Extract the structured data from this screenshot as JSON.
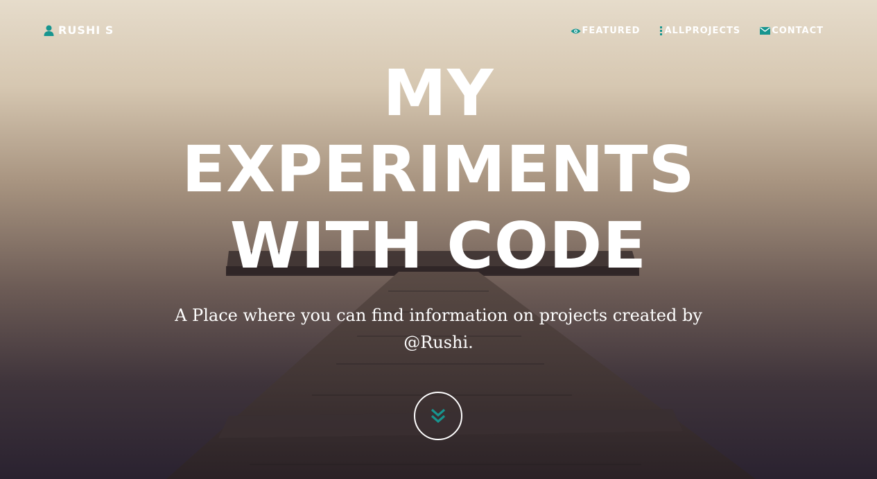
{
  "navbar": {
    "brand": {
      "label": "RUSHI S",
      "icon": "user-icon"
    },
    "links": [
      {
        "label": "FEATURED",
        "icon": "eye-icon"
      },
      {
        "label": "ALLPROJECTS",
        "icon": "list-icon"
      },
      {
        "label": "CONTACT",
        "icon": "envelope-icon"
      }
    ]
  },
  "hero": {
    "title_lines": [
      "MY",
      "EXPERIMENTS",
      "WITH CODE"
    ],
    "subtitle": "A Place where you can find information on projects created by @Rushi.",
    "scroll_icon": "double-chevron-down-icon"
  },
  "colors": {
    "accent": "#17958f",
    "text": "#ffffff"
  }
}
